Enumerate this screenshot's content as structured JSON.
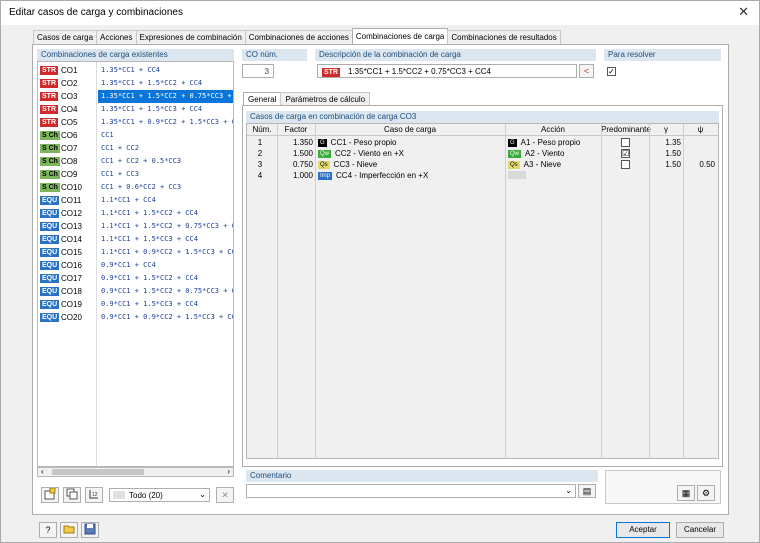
{
  "window": {
    "title": "Editar casos de carga y combinaciones",
    "close": "✕"
  },
  "tabs": [
    "Casos de carga",
    "Acciones",
    "Expresiones de combinación",
    "Combinaciones de acciones",
    "Combinaciones de carga",
    "Combinaciones de resultados"
  ],
  "left": {
    "header": "Combinaciones de carga existentes",
    "items": [
      {
        "tag": "STR",
        "co": "CO1",
        "formula": "1.35*CC1 + CC4"
      },
      {
        "tag": "STR",
        "co": "CO2",
        "formula": "1.35*CC1 + 1.5*CC2 + CC4"
      },
      {
        "tag": "STR",
        "co": "CO3",
        "formula": "1.35*CC1 + 1.5*CC2 + 0.75*CC3 + CC4"
      },
      {
        "tag": "STR",
        "co": "CO4",
        "formula": "1.35*CC1 + 1.5*CC3 + CC4"
      },
      {
        "tag": "STR",
        "co": "CO5",
        "formula": "1.35*CC1 + 0.9*CC2 + 1.5*CC3 + CC4"
      },
      {
        "tag": "S Ch",
        "co": "CO6",
        "formula": "CC1"
      },
      {
        "tag": "S Ch",
        "co": "CO7",
        "formula": "CC1 + CC2"
      },
      {
        "tag": "S Ch",
        "co": "CO8",
        "formula": "CC1 + CC2 + 0.5*CC3"
      },
      {
        "tag": "S Ch",
        "co": "CO9",
        "formula": "CC1 + CC3"
      },
      {
        "tag": "S Ch",
        "co": "CO10",
        "formula": "CC1 + 0.6*CC2 + CC3"
      },
      {
        "tag": "EQU",
        "co": "CO11",
        "formula": "1.1*CC1 + CC4"
      },
      {
        "tag": "EQU",
        "co": "CO12",
        "formula": "1.1*CC1 + 1.5*CC2 + CC4"
      },
      {
        "tag": "EQU",
        "co": "CO13",
        "formula": "1.1*CC1 + 1.5*CC2 + 0.75*CC3 + CC4"
      },
      {
        "tag": "EQU",
        "co": "CO14",
        "formula": "1.1*CC1 + 1.5*CC3 + CC4"
      },
      {
        "tag": "EQU",
        "co": "CO15",
        "formula": "1.1*CC1 + 0.9*CC2 + 1.5*CC3 + CC4"
      },
      {
        "tag": "EQU",
        "co": "CO16",
        "formula": "0.9*CC1 + CC4"
      },
      {
        "tag": "EQU",
        "co": "CO17",
        "formula": "0.9*CC1 + 1.5*CC2 + CC4"
      },
      {
        "tag": "EQU",
        "co": "CO18",
        "formula": "0.9*CC1 + 1.5*CC2 + 0.75*CC3 + CC4"
      },
      {
        "tag": "EQU",
        "co": "CO19",
        "formula": "0.9*CC1 + 1.5*CC3 + CC4"
      },
      {
        "tag": "EQU",
        "co": "CO20",
        "formula": "0.9*CC1 + 0.9*CC2 + 1.5*CC3 + CC4"
      }
    ],
    "filter": "Todo (20)"
  },
  "top": {
    "co_label": "CO núm.",
    "co_value": "3",
    "desc_label": "Descripción de la combinación de carga",
    "desc_tag": "STR",
    "desc_value": "1.35*CC1 + 1.5*CC2 + 0.75*CC3 + CC4",
    "resolve_label": "Para resolver"
  },
  "subtabs": [
    "General",
    "Parámetros de cálculo"
  ],
  "table": {
    "header": "Casos de carga en combinación de carga CO3",
    "columns": [
      "Núm.",
      "Factor",
      "Caso de carga",
      "Acción",
      "Predominante",
      "γ",
      "ψ"
    ],
    "rows": [
      {
        "num": "1",
        "factor": "1.350",
        "cc_badge": "G",
        "cc": "CC1 - Peso propio",
        "act_badge": "G",
        "action": "A1 - Peso propio",
        "pred": "",
        "gamma": "1.35",
        "psi": ""
      },
      {
        "num": "2",
        "factor": "1.500",
        "cc_badge": "Qw",
        "cc": "CC2 - Viento en +X",
        "act_badge": "Qw",
        "action": "A2 - Viento",
        "pred": "☑",
        "gamma": "1.50",
        "psi": ""
      },
      {
        "num": "3",
        "factor": "0.750",
        "cc_badge": "Qs",
        "cc": "CC3 - Nieve",
        "act_badge": "Qs",
        "action": "A3 - Nieve",
        "pred": "",
        "gamma": "1.50",
        "psi": "0.50"
      },
      {
        "num": "4",
        "factor": "1.000",
        "cc_badge": "Imp",
        "cc": "CC4 - Imperfección en +X",
        "act_badge": "",
        "action": "",
        "pred": "",
        "gamma": "",
        "psi": ""
      }
    ]
  },
  "comment_label": "Comentario",
  "buttons": {
    "accept": "Aceptar",
    "cancel": "Cancelar"
  }
}
